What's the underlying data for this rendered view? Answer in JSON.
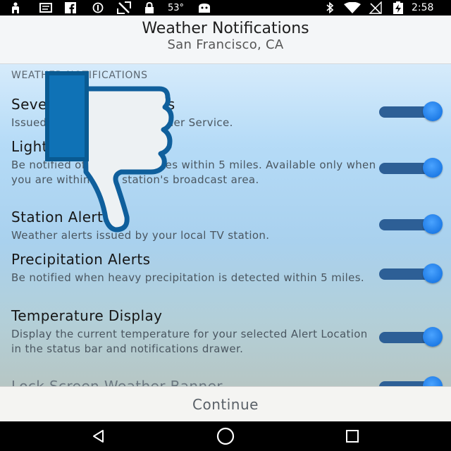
{
  "status_bar": {
    "temperature": "53°",
    "time": "2:58",
    "icons_left": [
      "person-icon",
      "message-icon",
      "facebook-icon",
      "block-icon",
      "no-sim-icon",
      "lock-icon",
      "temperature-text",
      "android-icon"
    ],
    "icons_right": [
      "bluetooth-icon",
      "wifi-icon",
      "signal-off-icon",
      "battery-charging-icon"
    ]
  },
  "header": {
    "title": "Weather Notifications",
    "subtitle": "San Francisco, CA"
  },
  "section": {
    "title": "WEATHER NOTIFICATIONS"
  },
  "settings": [
    {
      "name": "Severe Weather Alerts",
      "description": "Issued by the National Weather Service.",
      "enabled": true
    },
    {
      "name": "Lightning Alerts",
      "description": "Be notified of lightning strikes within 5 miles. Available only when you are within your station's broadcast area.",
      "enabled": true
    },
    {
      "name": "Station Alerts",
      "description": "Weather alerts issued by your local TV station.",
      "enabled": true
    },
    {
      "name": "Precipitation Alerts",
      "description": "Be notified when heavy precipitation is detected within 5 miles.",
      "enabled": true
    },
    {
      "name": "Temperature Display",
      "description": "Display the current temperature for your selected Alert Location in the status bar and notifications drawer.",
      "enabled": true
    },
    {
      "name": "Lock Screen Weather Banner",
      "description": "",
      "enabled": true
    }
  ],
  "footer": {
    "continue_label": "Continue"
  },
  "overlay": {
    "icon": "thumbs-down-icon"
  },
  "colors": {
    "toggle_track": "#2d5f96",
    "toggle_knob": "#1e7be6",
    "overlay_fill": "#0f72b6",
    "overlay_outline": "#095a92"
  }
}
